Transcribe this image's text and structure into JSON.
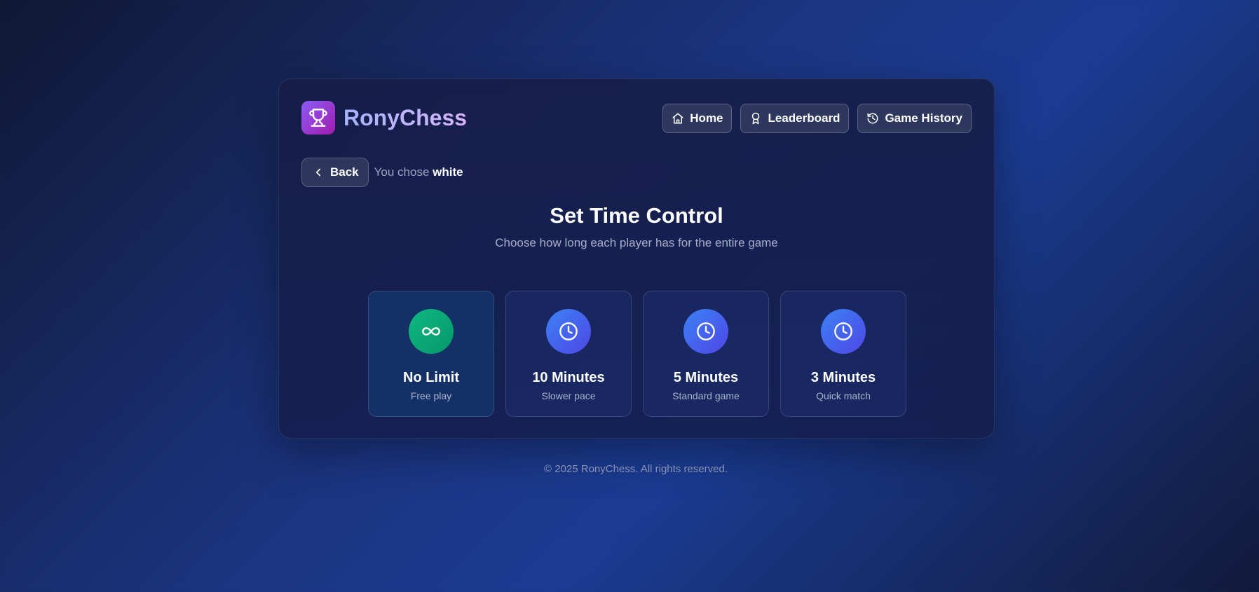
{
  "app": {
    "name": "RonyChess"
  },
  "nav": [
    {
      "label": "Home",
      "icon": "home-icon"
    },
    {
      "label": "Leaderboard",
      "icon": "award-icon"
    },
    {
      "label": "Game History",
      "icon": "history-icon"
    }
  ],
  "back": {
    "label": "Back"
  },
  "selection": {
    "prefix": "You chose",
    "color": "white"
  },
  "page": {
    "title": "Set Time Control",
    "subtitle": "Choose how long each player has for the entire game"
  },
  "options": [
    {
      "name": "No Limit",
      "desc": "Free play",
      "icon": "infinity-icon",
      "selected": true
    },
    {
      "name": "10 Minutes",
      "desc": "Slower pace",
      "icon": "clock-icon",
      "selected": false
    },
    {
      "name": "5 Minutes",
      "desc": "Standard game",
      "icon": "clock-icon",
      "selected": false
    },
    {
      "name": "3 Minutes",
      "desc": "Quick match",
      "icon": "clock-icon",
      "selected": false
    }
  ],
  "footer": {
    "text": "© 2025 RonyChess. All rights reserved."
  },
  "colors": {
    "accent": "#8b5cf6",
    "green": "#10b981",
    "blue": "#3b82f6"
  }
}
